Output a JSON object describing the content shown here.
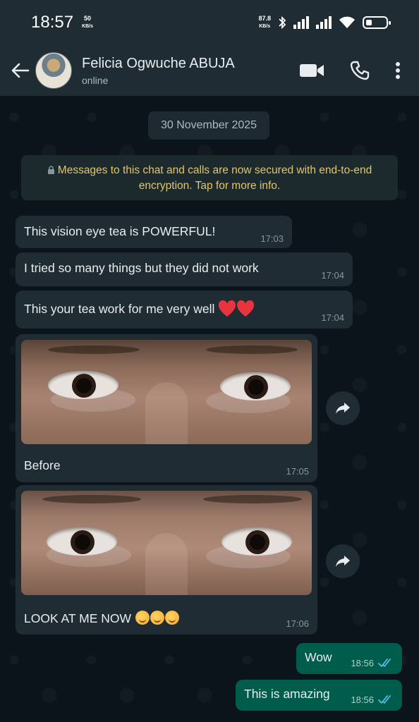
{
  "status_bar": {
    "time": "18:57",
    "left_speed_value": "50",
    "left_speed_unit": "KB/s",
    "right_speed_value": "87.8",
    "right_speed_unit": "KB/s",
    "icons": [
      "bluetooth-icon",
      "signal-icon",
      "signal-icon",
      "wifi-icon",
      "battery-icon"
    ]
  },
  "header": {
    "contact_name": "Felicia Ogwuche ABUJA",
    "status": "online",
    "actions": [
      "video-call-icon",
      "voice-call-icon",
      "more-options-icon"
    ]
  },
  "chat": {
    "date_chip": "30 November 2025",
    "encryption_notice": "Messages to this chat and calls are now secured with end-to-end encryption. Tap for more info.",
    "messages": [
      {
        "direction": "incoming",
        "text": "This vision eye tea is POWERFUL!",
        "time": "17:03"
      },
      {
        "direction": "incoming",
        "text": "I tried so many things but they did not work",
        "time": "17:04"
      },
      {
        "direction": "incoming",
        "text": "This your tea work for me very well",
        "emoji": "❤️❤️",
        "time": "17:04"
      },
      {
        "direction": "incoming",
        "type": "image",
        "caption": "Before",
        "time": "17:05"
      },
      {
        "direction": "incoming",
        "type": "image",
        "caption": "LOOK AT ME NOW",
        "emoji": "🥰🥰🥰",
        "time": "17:06"
      },
      {
        "direction": "outgoing",
        "text": "Wow",
        "time": "18:56",
        "status": "read"
      },
      {
        "direction": "outgoing",
        "text": "This is amazing",
        "time": "18:56",
        "status": "read"
      }
    ]
  },
  "colors": {
    "header_bg": "#1f2c33",
    "chat_bg": "#0b141a",
    "incoming_bubble": "#1f2c33",
    "outgoing_bubble": "#005c4b",
    "read_ticks": "#53bdeb",
    "encryption_text": "#e3c56a"
  }
}
